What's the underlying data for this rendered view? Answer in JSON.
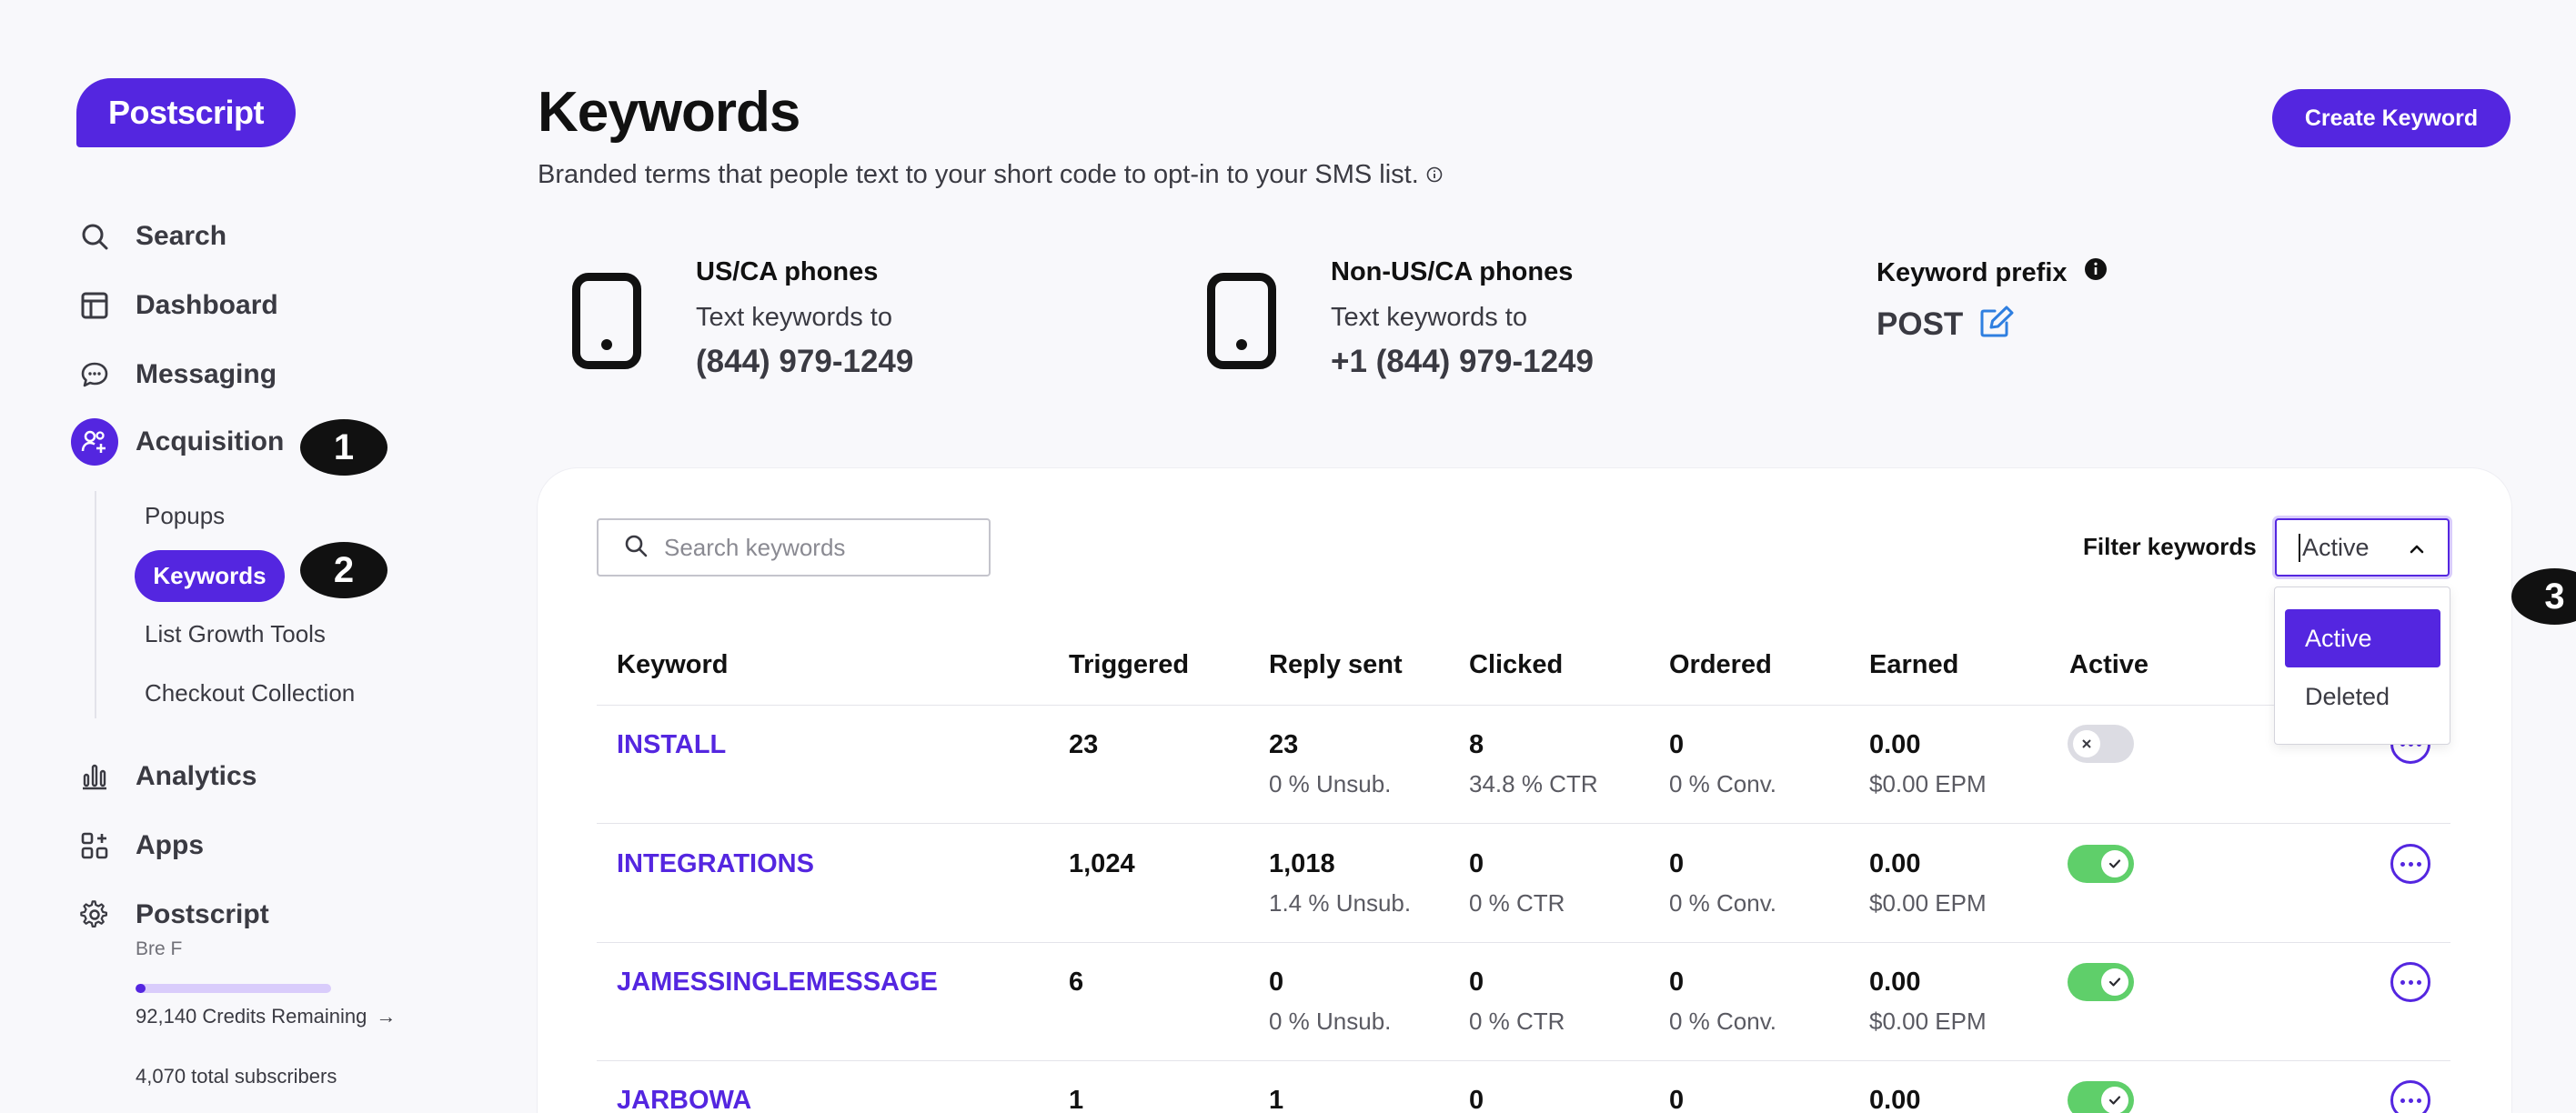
{
  "brand": {
    "logo_text": "Postscript",
    "accent": "#5426e0"
  },
  "sidebar": {
    "items": [
      {
        "label": "Search",
        "icon": "search-icon"
      },
      {
        "label": "Dashboard",
        "icon": "dashboard-icon"
      },
      {
        "label": "Messaging",
        "icon": "chat-bubble-icon"
      },
      {
        "label": "Acquisition",
        "icon": "users-plus-icon",
        "active": true
      },
      {
        "label": "Analytics",
        "icon": "bar-chart-icon"
      },
      {
        "label": "Apps",
        "icon": "apps-grid-icon"
      }
    ],
    "acquisition_sub": [
      "Popups",
      "Keywords",
      "List Growth Tools",
      "Checkout Collection"
    ],
    "account": {
      "name": "Postscript",
      "user": "Bre F",
      "credits_text": "92,140 Credits Remaining",
      "credits_arrow": "→",
      "credits_fraction": 0.05,
      "subscribers_text": "4,070 total subscribers"
    }
  },
  "annotations": [
    "1",
    "2",
    "3"
  ],
  "header": {
    "title": "Keywords",
    "subtitle": "Branded terms that people text to your short code to opt-in to your SMS list.",
    "create_button": "Create Keyword"
  },
  "info": {
    "us": {
      "heading": "US/CA phones",
      "line": "Text keywords to",
      "number": "(844) 979-1249"
    },
    "intl": {
      "heading": "Non-US/CA phones",
      "line": "Text keywords to",
      "number": "+1 (844) 979-1249"
    },
    "prefix": {
      "heading": "Keyword prefix",
      "value": "POST"
    }
  },
  "table": {
    "search_placeholder": "Search keywords",
    "filter_label": "Filter keywords",
    "filter_value": "Active",
    "filter_options": [
      "Active",
      "Deleted"
    ],
    "columns": [
      "Keyword",
      "Triggered",
      "Reply sent",
      "Clicked",
      "Ordered",
      "Earned",
      "Active"
    ],
    "rows": [
      {
        "keyword": "INSTALL",
        "triggered": "23",
        "reply": "23",
        "reply_sub": "0 % Unsub.",
        "clicked": "8",
        "clicked_sub": "34.8 % CTR",
        "ordered": "0",
        "ordered_sub": "0 % Conv.",
        "earned": "0.00",
        "earned_sub": "$0.00 EPM",
        "active": false
      },
      {
        "keyword": "INTEGRATIONS",
        "triggered": "1,024",
        "reply": "1,018",
        "reply_sub": "1.4 % Unsub.",
        "clicked": "0",
        "clicked_sub": "0 % CTR",
        "ordered": "0",
        "ordered_sub": "0 % Conv.",
        "earned": "0.00",
        "earned_sub": "$0.00 EPM",
        "active": true
      },
      {
        "keyword": "JAMESSINGLEMESSAGE",
        "triggered": "6",
        "reply": "0",
        "reply_sub": "0 % Unsub.",
        "clicked": "0",
        "clicked_sub": "0 % CTR",
        "ordered": "0",
        "ordered_sub": "0 % Conv.",
        "earned": "0.00",
        "earned_sub": "$0.00 EPM",
        "active": true
      },
      {
        "keyword": "JARBOWA",
        "triggered": "1",
        "reply": "1",
        "clicked": "0",
        "ordered": "0",
        "earned": "0.00",
        "active": true
      }
    ]
  }
}
